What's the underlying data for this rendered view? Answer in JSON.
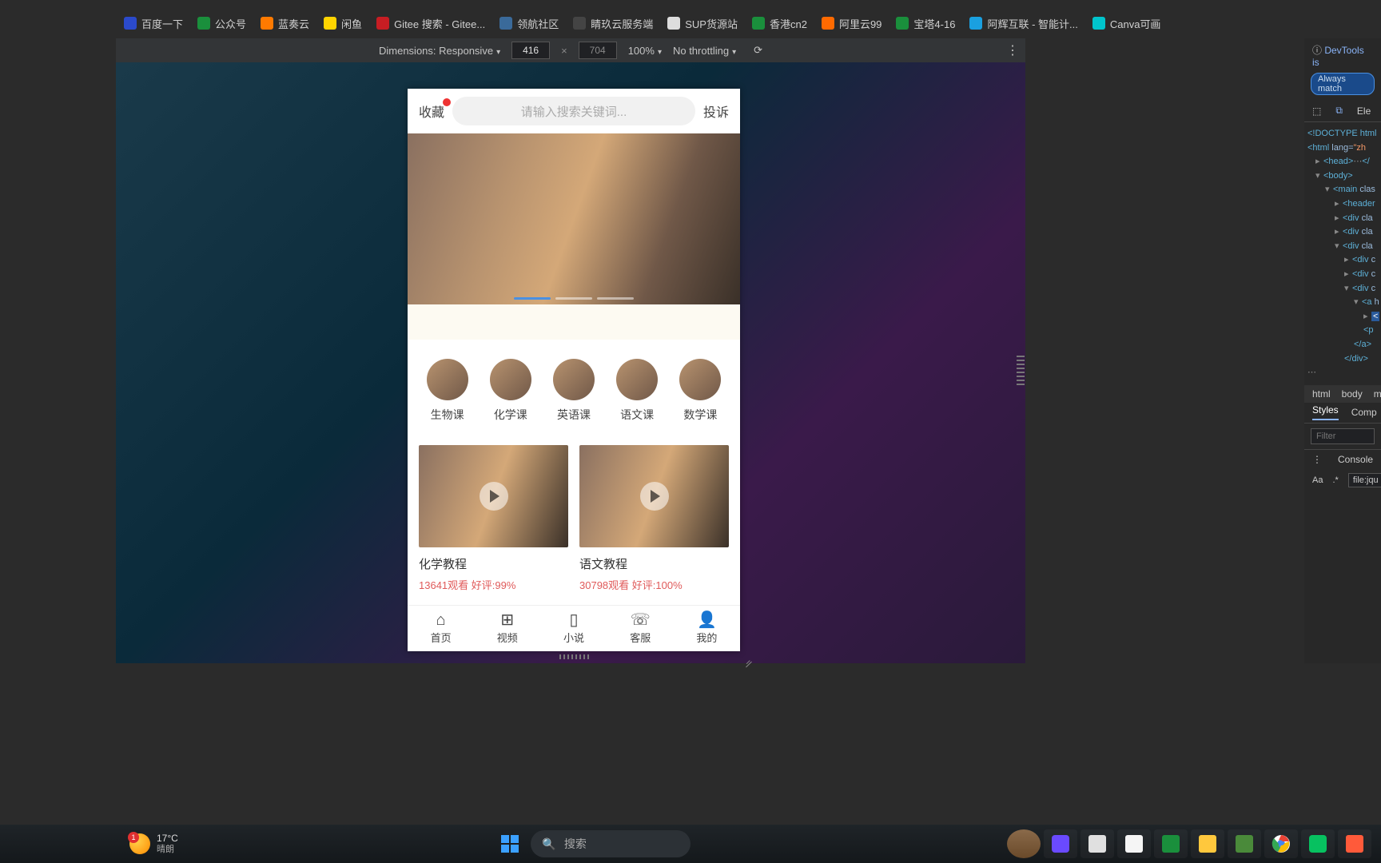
{
  "bookmarks": [
    {
      "label": "百度一下",
      "color": "#2b4acb"
    },
    {
      "label": "公众号",
      "color": "#1a8f3c"
    },
    {
      "label": "蓝奏云",
      "color": "#ff7a00"
    },
    {
      "label": "闲鱼",
      "color": "#ffd400"
    },
    {
      "label": "Gitee 搜索 - Gitee...",
      "color": "#c71d23"
    },
    {
      "label": "领航社区",
      "color": "#3a6a9a"
    },
    {
      "label": "睛玖云服务端",
      "color": "#444"
    },
    {
      "label": "SUP货源站",
      "color": "#ddd"
    },
    {
      "label": "香港cn2",
      "color": "#1a8f3c"
    },
    {
      "label": "阿里云99",
      "color": "#ff6a00"
    },
    {
      "label": "宝塔4-16",
      "color": "#1a8f3c"
    },
    {
      "label": "阿辉互联 - 智能计...",
      "color": "#1aa0e0"
    },
    {
      "label": "Canva可画",
      "color": "#00c4cc"
    }
  ],
  "deviceBar": {
    "dimensionsLabel": "Dimensions: Responsive",
    "width": "416",
    "height": "704",
    "zoom": "100%",
    "throttling": "No throttling"
  },
  "mobile": {
    "header": {
      "favLabel": "收藏",
      "searchPlaceholder": "请输入搜索关键词...",
      "complainLabel": "投诉"
    },
    "categories": [
      {
        "label": "生物课"
      },
      {
        "label": "化学课"
      },
      {
        "label": "英语课"
      },
      {
        "label": "语文课"
      },
      {
        "label": "数学课"
      }
    ],
    "videos": [
      {
        "title": "化学教程",
        "views": "13641观看",
        "rating": "好评:99%"
      },
      {
        "title": "语文教程",
        "views": "30798观看",
        "rating": "好评:100%"
      }
    ],
    "nav": [
      {
        "icon": "⌂",
        "label": "首页"
      },
      {
        "icon": "⊞",
        "label": "视频"
      },
      {
        "icon": "▯",
        "label": "小说"
      },
      {
        "icon": "☏",
        "label": "客服"
      },
      {
        "icon": "👤",
        "label": "我的"
      }
    ]
  },
  "devtools": {
    "infoText": "DevTools is",
    "pill": "Always match",
    "tabElements": "Ele",
    "doctype": "<!DOCTYPE html",
    "htmlOpen": "html",
    "htmlLang": "zh",
    "head": "head",
    "body": "body",
    "main": "main",
    "header": "header",
    "div": "div",
    "a": "a",
    "breadcrumb": [
      "html",
      "body",
      "m"
    ],
    "stylesTab": "Styles",
    "computedTab": "Comp",
    "filterPlaceholder": "Filter",
    "consoleLabel": "Console",
    "aa": "Aa",
    "fileLabel": "file:jqu"
  },
  "taskbar": {
    "temp": "17°C",
    "weather": "晴朗",
    "badge": "1",
    "searchPlaceholder": "搜索"
  }
}
